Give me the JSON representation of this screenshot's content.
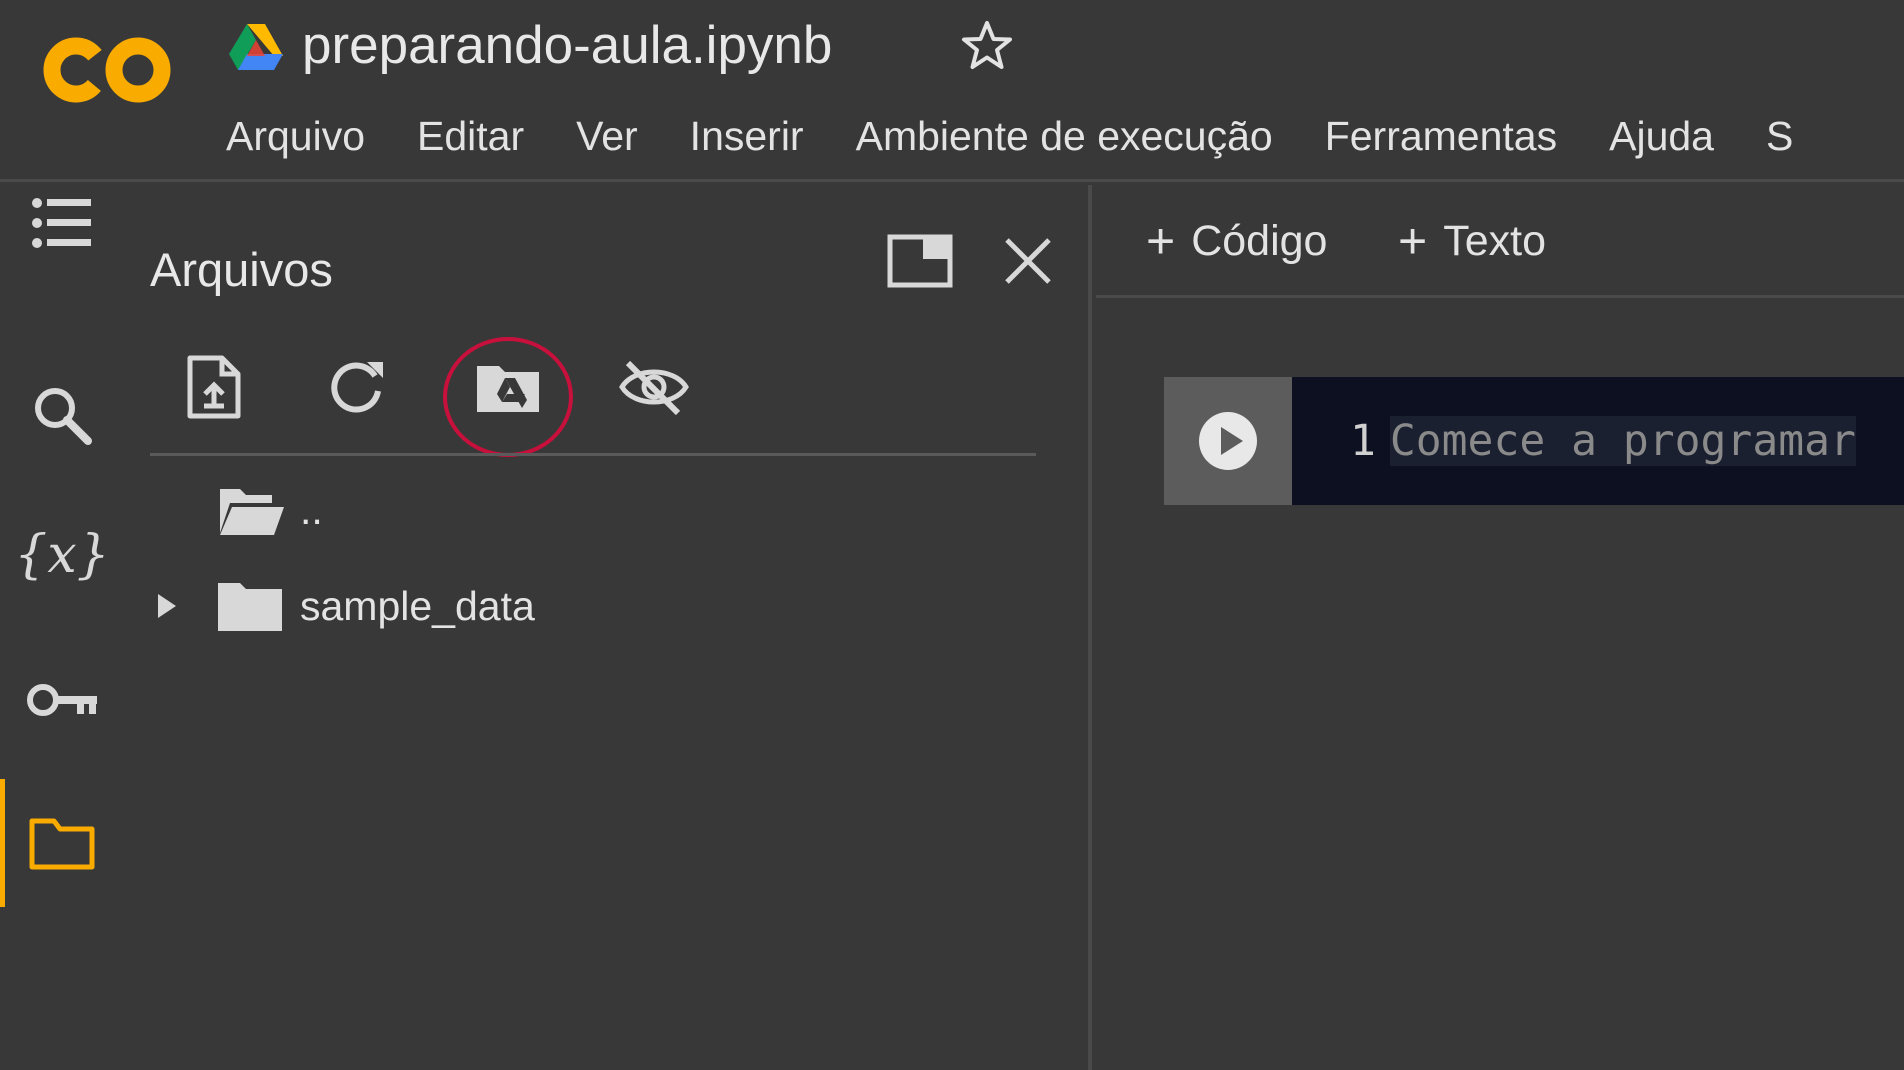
{
  "header": {
    "logo_text": "CO",
    "notebook_title": "preparando-aula.ipynb",
    "menu": [
      "Arquivo",
      "Editar",
      "Ver",
      "Inserir",
      "Ambiente de execução",
      "Ferramentas",
      "Ajuda",
      "S"
    ]
  },
  "activity_bar": {
    "items": [
      {
        "icon": "table-of-contents-icon"
      },
      {
        "icon": "search-icon"
      },
      {
        "icon": "variables-icon",
        "glyph": "{x}"
      },
      {
        "icon": "key-icon"
      },
      {
        "icon": "folder-icon",
        "active": true
      }
    ]
  },
  "files_panel": {
    "title": "Arquivos",
    "toolbar": [
      "upload-file-icon",
      "refresh-icon",
      "mount-drive-icon",
      "hide-eye-icon"
    ],
    "highlighted_tool": "mount-drive-icon",
    "tree": [
      {
        "label": "..",
        "icon": "folder-open-icon"
      },
      {
        "label": "sample_data",
        "icon": "folder-icon",
        "expandable": true
      }
    ]
  },
  "notebook": {
    "add_code_label": "Código",
    "add_text_label": "Texto",
    "cell": {
      "line_number": "1",
      "placeholder": "Comece a programar"
    }
  },
  "colors": {
    "background": "#383838",
    "accent_active": "#f9ab00",
    "highlight_ring": "#c8103c",
    "editor_bg": "#0c1021",
    "run_button_bg": "#5c5c5c"
  }
}
